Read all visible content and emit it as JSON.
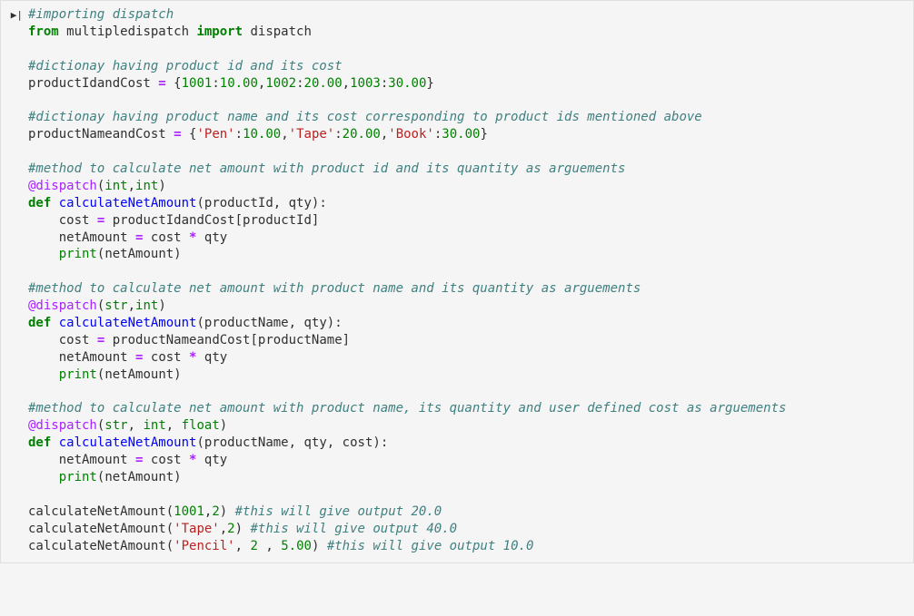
{
  "cell": {
    "prompt_icon": "▶|",
    "lines": {
      "c_import": "#importing dispatch",
      "kw_from": "from",
      "mod_multipledispatch": "multipledispatch",
      "kw_import": "import",
      "name_dispatch": "dispatch",
      "c_dict1": "#dictionay having product id and its cost",
      "name_productIdandCost": "productIdandCost",
      "eq": "=",
      "lbrace": "{",
      "rbrace": "}",
      "num_1001": "1001",
      "num_1002": "1002",
      "num_1003": "1003",
      "num_10_00": "10.00",
      "num_20_00": "20.00",
      "num_30_00": "30.00",
      "colon": ":",
      "comma": ",",
      "c_dict2": "#dictionay having product name and its cost corresponding to product ids mentioned above",
      "name_productNameandCost": "productNameandCost",
      "str_Pen": "'Pen'",
      "str_Tape": "'Tape'",
      "str_Book": "'Book'",
      "c_method1": "#method to calculate net amount with product id and its quantity as arguements",
      "dec_at_dispatch": "@dispatch",
      "lparen": "(",
      "rparen": ")",
      "type_int": "int",
      "type_str": "str",
      "type_float": "float",
      "kw_def": "def",
      "fn_calculateNetAmount": "calculateNetAmount",
      "arg_productId": "productId",
      "arg_qty": "qty",
      "arg_productName": "productName",
      "arg_cost": "cost",
      "name_cost": "cost",
      "lbracket": "[",
      "rbracket": "]",
      "name_netAmount": "netAmount",
      "op_mul": "*",
      "builtin_print": "print",
      "c_method2": "#method to calculate net amount with product name and its quantity as arguements",
      "c_method3": "#method to calculate net amount with product name, its quantity and user defined cost as arguements",
      "num_2": "2",
      "num_5_00": "5.00",
      "str_Pencil": "'Pencil'",
      "c_out20": "#this will give output 20.0",
      "c_out40": "#this will give output 40.0",
      "c_out10": "#this will give output 10.0",
      "space": " "
    }
  }
}
